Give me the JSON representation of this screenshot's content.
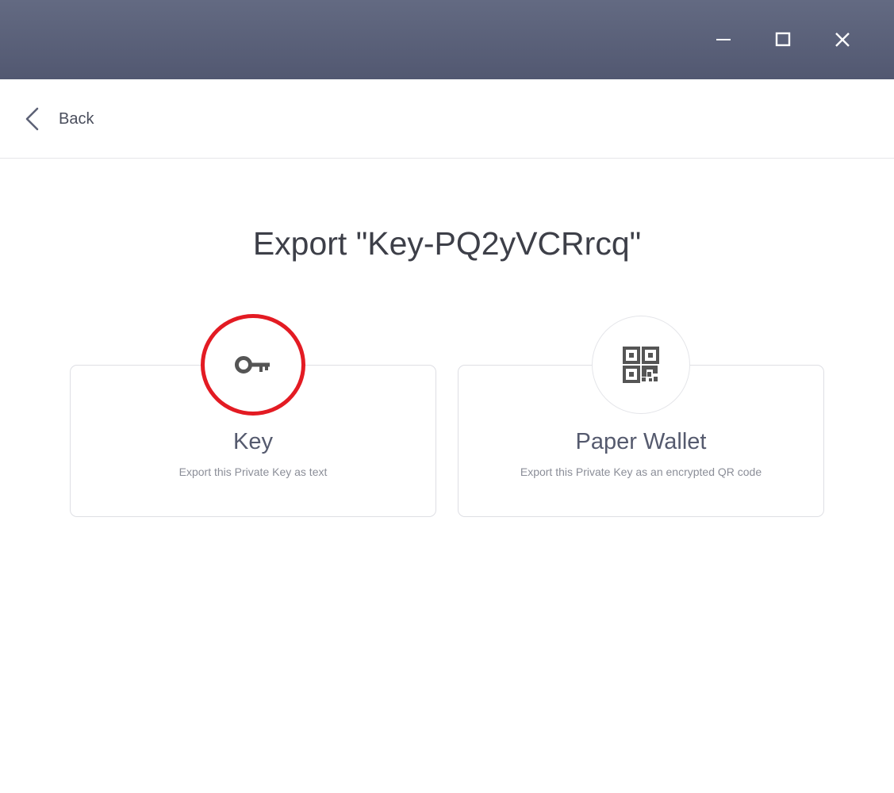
{
  "window": {
    "controls": [
      "minimize-icon",
      "maximize-icon",
      "close-icon"
    ],
    "titlebar_color": "#5a6079"
  },
  "header": {
    "back_label": "Back",
    "back_icon": "chevron-left-icon"
  },
  "main": {
    "title": "Export \"Key-PQ2yVCRrcq\"",
    "options": [
      {
        "title": "Key",
        "description": "Export this Private Key as text",
        "icon": "key-icon",
        "highlighted": true
      },
      {
        "title": "Paper Wallet",
        "description": "Export this Private Key as an encrypted QR code",
        "icon": "qr-code-icon",
        "highlighted": false
      }
    ]
  },
  "colors": {
    "highlight": "#e31b23",
    "icon": "#555555",
    "text_title": "#3d3f48"
  }
}
